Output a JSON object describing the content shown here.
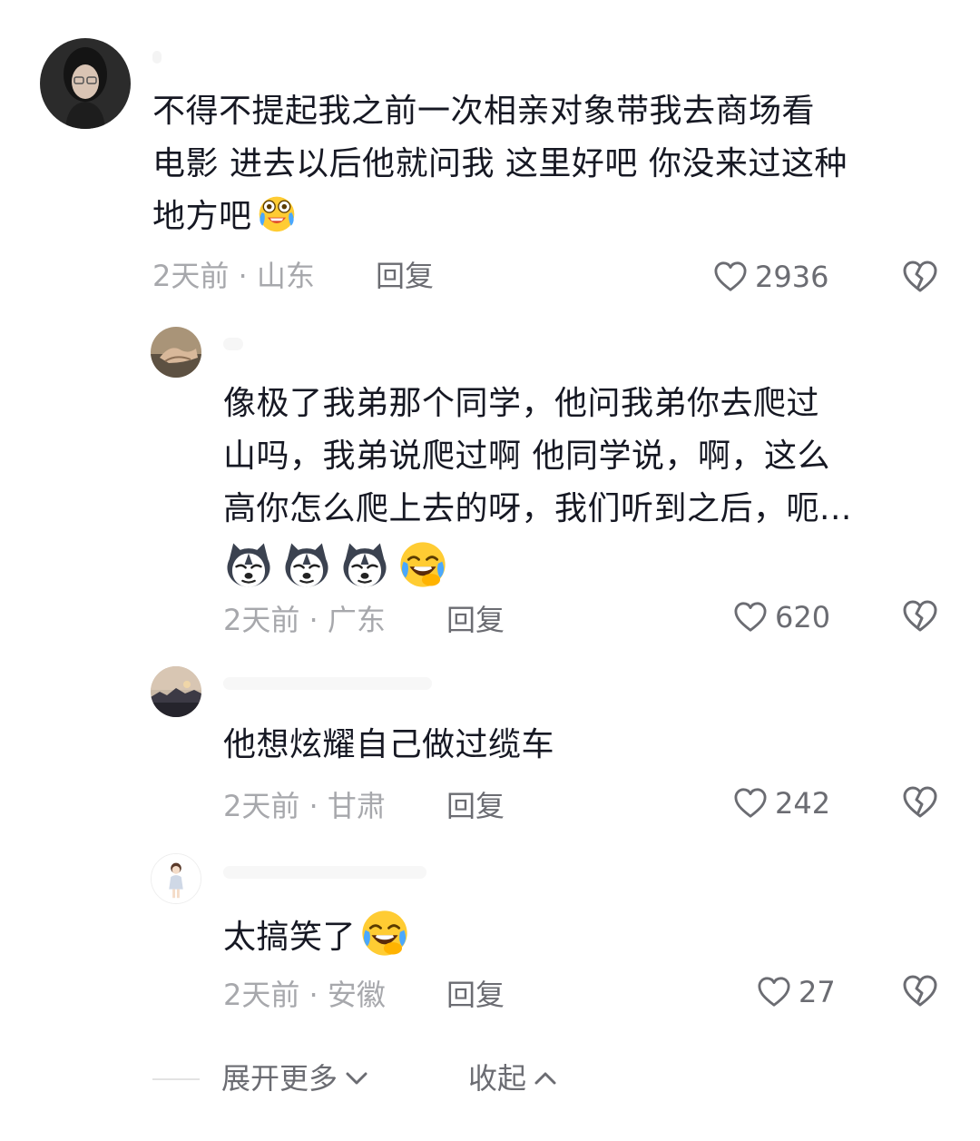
{
  "comments": [
    {
      "lines": [
        "不得不提起我之前一次相亲对象带我去商场看",
        "电影 进去以后他就问我 这里好吧 你没来过这种",
        "地方吧"
      ],
      "emoji": [
        "crying-laughing-emoji"
      ],
      "time": "2天前",
      "location": "山东",
      "reply": "回复",
      "likes": "2936"
    },
    {
      "lines": [
        "像极了我弟那个同学，他问我弟你去爬过",
        "山吗，我弟说爬过啊 他同学说，啊，这么",
        "高你怎么爬上去的呀，我们听到之后，呃..."
      ],
      "emoji": [
        "husky-emoji",
        "husky-emoji",
        "husky-emoji",
        "rofl-emoji"
      ],
      "time": "2天前",
      "location": "广东",
      "reply": "回复",
      "likes": "620"
    },
    {
      "lines": [
        "他想炫耀自己做过缆车"
      ],
      "time": "2天前",
      "location": "甘肃",
      "reply": "回复",
      "likes": "242"
    },
    {
      "lines": [
        "太搞笑了"
      ],
      "emoji": [
        "rofl-emoji"
      ],
      "time": "2天前",
      "location": "安徽",
      "reply": "回复",
      "likes": "27"
    }
  ],
  "footer": {
    "expand_label": "展开更多",
    "collapse_label": "收起"
  },
  "colors": {
    "text": "#161823",
    "meta": "#a7a8ac",
    "action": "#6b6c72"
  }
}
